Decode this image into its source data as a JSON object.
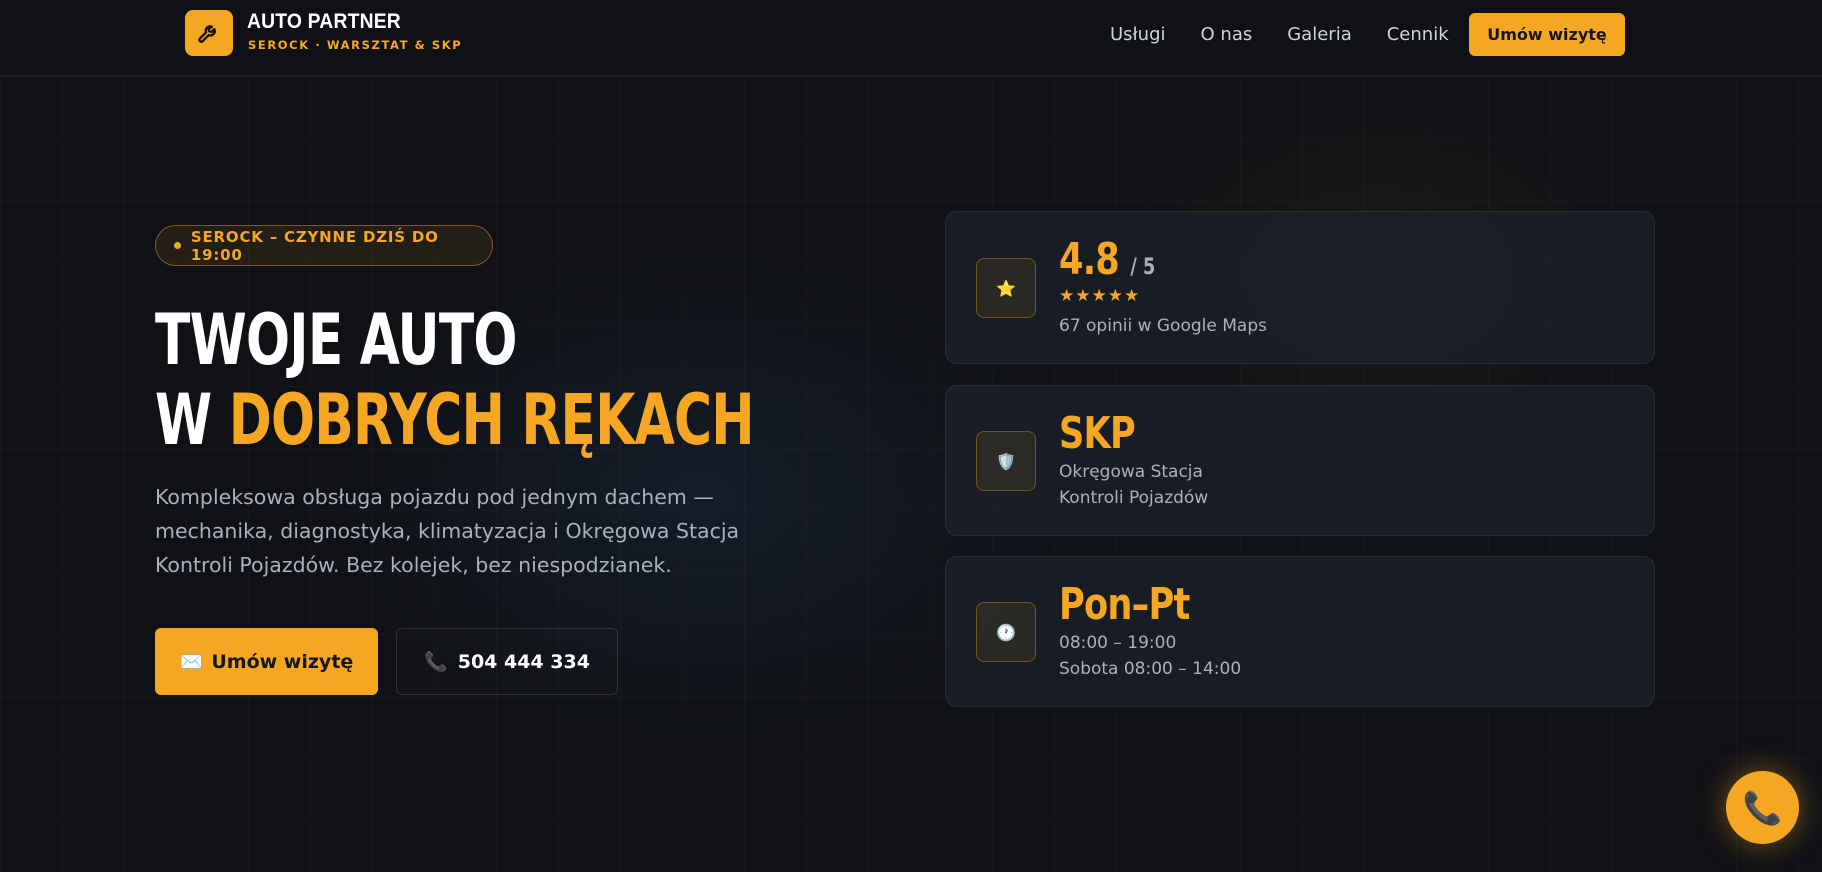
{
  "brand": {
    "name": "AUTO PARTNER",
    "tagline": "SEROCK · WARSZTAT & SKP",
    "logo_icon": "wrench-icon"
  },
  "nav": {
    "items": [
      "Usługi",
      "O nas",
      "Galeria",
      "Cennik"
    ],
    "cta_label": "Umów wizytę"
  },
  "hero": {
    "badge": "SEROCK – CZYNNE DZIŚ DO 19:00",
    "headline_line1": "TWOJE AUTO",
    "headline_line2_prefix": "W ",
    "headline_line2_accent": "DOBRYCH RĘKACH",
    "lead": "Kompleksowa obsługa pojazdu pod jednym dachem — mechanika, diagnostyka, klimatyzacja i Okręgowa Stacja Kontroli Pojazdów. Bez kolejek, bez niespodzianek.",
    "primary_icon": "✉️",
    "primary_label": "Umów wizytę",
    "phone_icon": "📞",
    "phone_label": "504 444 334"
  },
  "cards": {
    "rating": {
      "icon": "⭐",
      "value": "4.8",
      "scale": "/ 5",
      "stars": "★★★★★",
      "stars_value": 5,
      "caption": "67 opinii w Google Maps"
    },
    "skp": {
      "icon": "🛡️",
      "title": "SKP",
      "line1": "Okręgowa Stacja",
      "line2": "Kontroli Pojazdów"
    },
    "hours": {
      "icon": "🕐",
      "title": "Pon–Pt",
      "line1": "08:00 – 19:00",
      "line2": "Sobota 08:00 – 14:00"
    }
  },
  "fab": {
    "icon": "📞"
  },
  "colors": {
    "accent": "#f5a623",
    "background": "#0f1115",
    "card": "#1c212c",
    "muted_text": "#aab1bd"
  }
}
